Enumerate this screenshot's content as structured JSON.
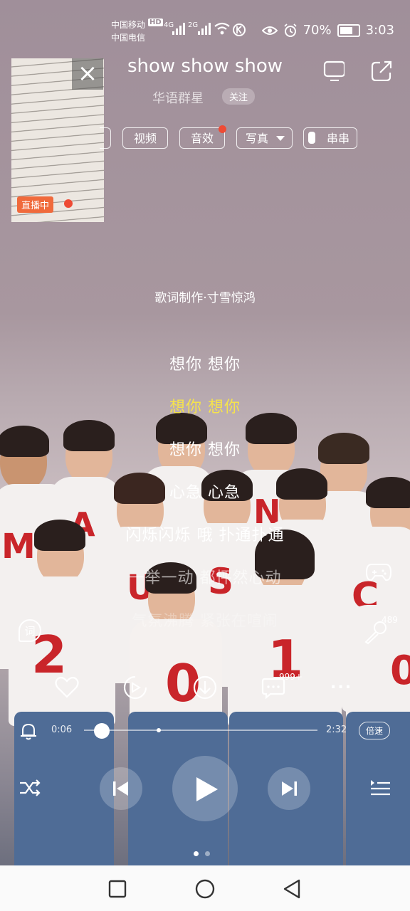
{
  "status_bar": {
    "carrier_1": "中国移动",
    "carrier_1_badge": "HD",
    "carrier_2": "中国电信",
    "net_1": "4G",
    "net_2": "2G",
    "battery": "70%",
    "time": "3:03"
  },
  "live_window": {
    "badge": "直播中"
  },
  "header": {
    "title": "show show show",
    "artist": "华语群星",
    "follow": "关注"
  },
  "tabs": [
    {
      "label": "视频"
    },
    {
      "label": "音效"
    },
    {
      "label": "写真"
    },
    {
      "label": "串串"
    }
  ],
  "lyrics": {
    "credits": "歌词制作·寸雪惊鸿",
    "lines": [
      "想你 想你",
      "想你 想你",
      "想你 想你",
      "心急 心急",
      "闪烁闪烁 哦 扑通扑通",
      "一举一动 都怦然心动",
      "气氛沸腾 紧张在喧闹"
    ],
    "active_index": 1
  },
  "side": {
    "lyric_toggle": "词",
    "mic_count": "489"
  },
  "actions": {
    "comment_count": "999+",
    "more": "..."
  },
  "progress": {
    "current": "0:06",
    "total": "2:32",
    "speed": "倍速",
    "fraction": 0.04
  },
  "pager": {
    "count": 2,
    "active": 0
  },
  "colors": {
    "active_lyric": "#f5e34c",
    "live_badge": "#f06a3c",
    "notify_dot": "#ee4b35"
  }
}
